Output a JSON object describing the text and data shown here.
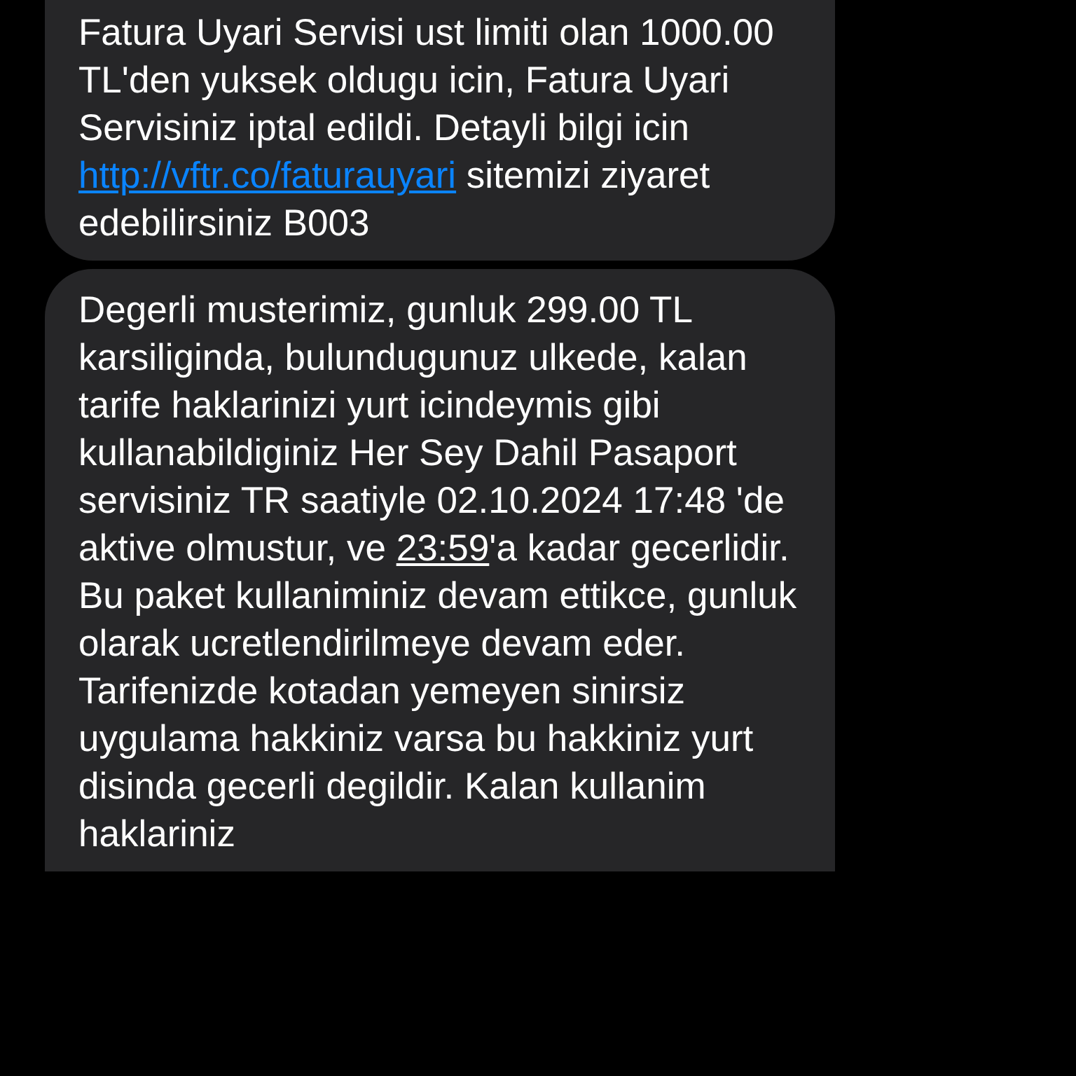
{
  "messages": [
    {
      "parts": [
        {
          "kind": "text",
          "text": "Fatura Uyari Servisi ust limiti olan 1000.00 TL'den yuksek oldugu icin, Fatura Uyari Servisiniz iptal edildi. Detayli bilgi icin "
        },
        {
          "kind": "link",
          "text": "http://vftr.co/faturauyari"
        },
        {
          "kind": "text",
          "text": " sitemizi ziyaret edebilirsiniz  B003"
        }
      ]
    },
    {
      "parts": [
        {
          "kind": "text",
          "text": "Degerli musterimiz, gunluk 299.00 TL karsiliginda, bulundugunuz ulkede, kalan tarife haklarinizi yurt icindeymis gibi kullanabildiginiz Her Sey Dahil Pasaport servisiniz TR saatiyle 02.10.2024 17:48 'de aktive olmustur, ve "
        },
        {
          "kind": "detected",
          "text": "23:59"
        },
        {
          "kind": "text",
          "text": "'a kadar gecerlidir. Bu paket kullaniminiz devam ettikce, gunluk olarak ucretlendirilmeye devam eder. Tarifenizde kotadan yemeyen sinirsiz uygulama hakkiniz varsa bu hakkiniz yurt disinda gecerli degildir. Kalan kullanim haklariniz"
        }
      ]
    }
  ]
}
